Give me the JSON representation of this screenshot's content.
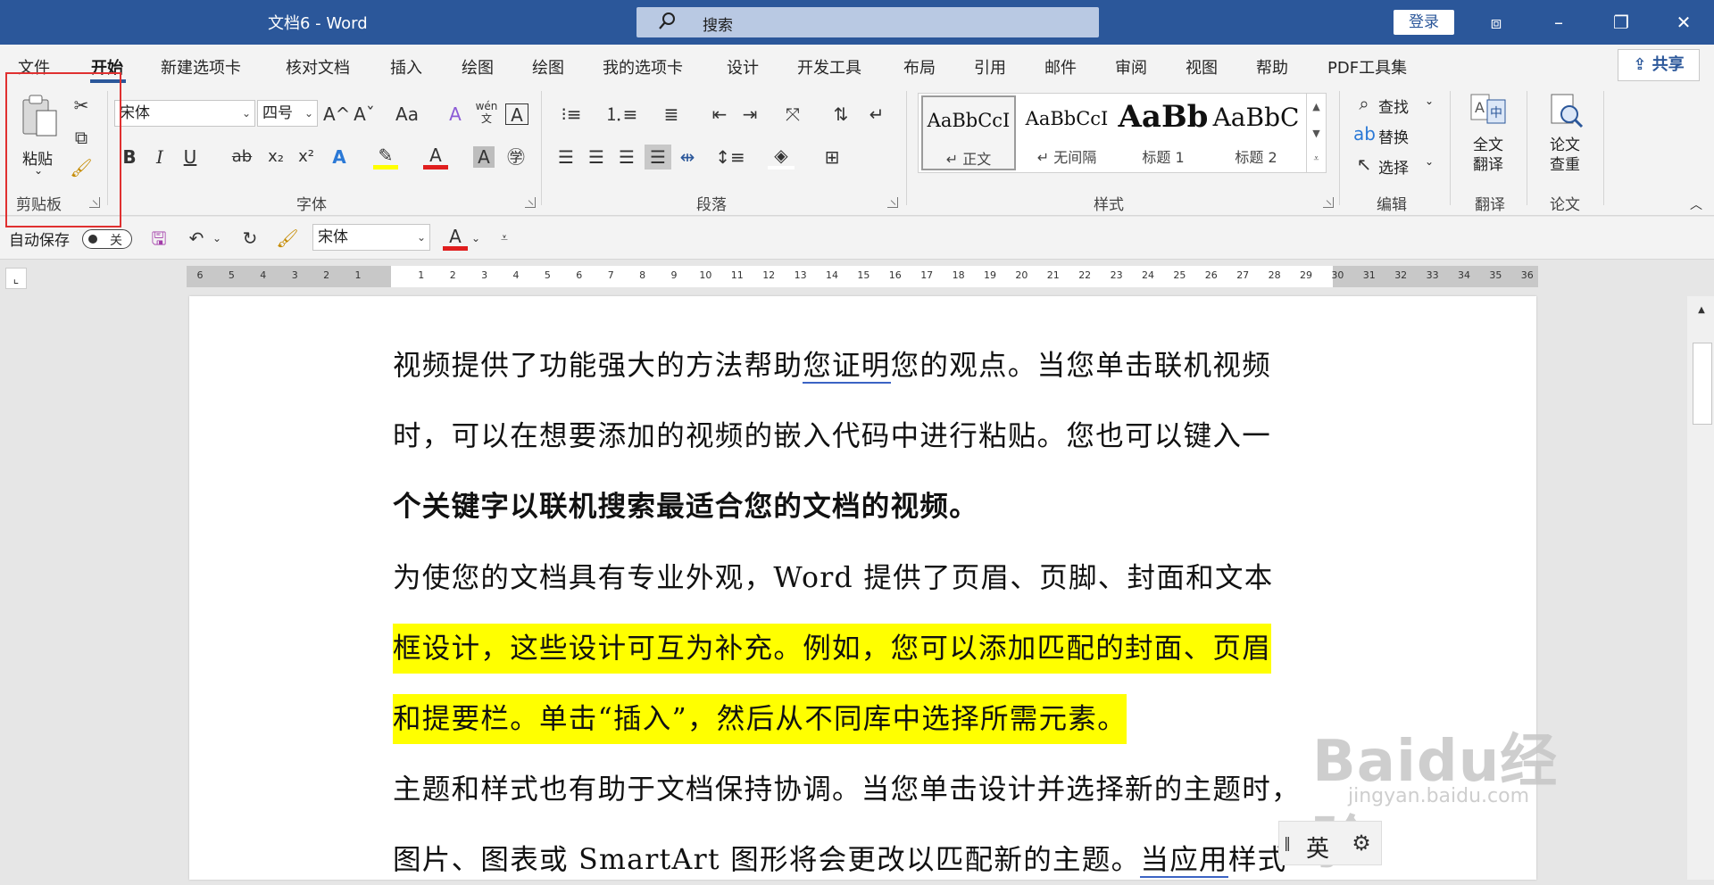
{
  "titlebar": {
    "title": "文档6  -  Word",
    "search_placeholder": "搜索",
    "login": "登录",
    "restore_ribbon": "⧈",
    "minimize": "–",
    "maximize": "❐",
    "close": "✕"
  },
  "tabs": [
    {
      "label": "文件"
    },
    {
      "label": "开始"
    },
    {
      "label": "新建选项卡"
    },
    {
      "label": "核对文档"
    },
    {
      "label": "插入"
    },
    {
      "label": "绘图"
    },
    {
      "label": "绘图"
    },
    {
      "label": "我的选项卡"
    },
    {
      "label": "设计"
    },
    {
      "label": "开发工具"
    },
    {
      "label": "布局"
    },
    {
      "label": "引用"
    },
    {
      "label": "邮件"
    },
    {
      "label": "审阅"
    },
    {
      "label": "视图"
    },
    {
      "label": "帮助"
    },
    {
      "label": "PDF工具集"
    }
  ],
  "share": "共享",
  "clipboard": {
    "paste": "粘贴",
    "group": "剪贴板"
  },
  "font": {
    "name": "宋体",
    "size": "四号",
    "group": "字体",
    "grow": "A^",
    "shrink": "Aˇ",
    "case": "Aa",
    "bold": "B",
    "italic": "I",
    "underline": "U",
    "strike": "ab",
    "sub": "x₂",
    "sup": "x²",
    "phonetic": "wén",
    "enclose": "A"
  },
  "paragraph": {
    "group": "段落"
  },
  "styles": {
    "group": "样式",
    "items": [
      {
        "preview": "AaBbCcI",
        "name": "↵ 正文"
      },
      {
        "preview": "AaBbCcI",
        "name": "↵ 无间隔"
      },
      {
        "preview": "AaBb",
        "name": "标题 1"
      },
      {
        "preview": "AaBbC",
        "name": "标题 2"
      }
    ]
  },
  "editing": {
    "find": "查找",
    "replace": "替换",
    "select": "选择",
    "group": "编辑"
  },
  "translate": {
    "label_1": "全文",
    "label_2": "翻译",
    "group": "翻译"
  },
  "paper": {
    "label_1": "论文",
    "label_2": "查重",
    "group": "论文"
  },
  "qat": {
    "autosave": "自动保存",
    "toggle": "关",
    "font": "宋体"
  },
  "ruler_numbers": [
    "6",
    "5",
    "4",
    "3",
    "2",
    "1",
    "",
    "1",
    "2",
    "3",
    "4",
    "5",
    "6",
    "7",
    "8",
    "9",
    "10",
    "11",
    "12",
    "13",
    "14",
    "15",
    "16",
    "17",
    "18",
    "19",
    "20",
    "21",
    "22",
    "23",
    "24",
    "25",
    "26",
    "27",
    "28",
    "29",
    "30",
    "31",
    "32",
    "33",
    "34",
    "35",
    "36"
  ],
  "document": {
    "lines": [
      {
        "a": "视频提供了功能强大的方法帮助",
        "u": "您证明",
        "b": "您的观点。当您单击联机视频"
      },
      {
        "text": "时，可以在想要添加的视频的嵌入代码中进行粘贴。您也可以键入一"
      },
      {
        "text": "个关键字以联机搜索最适合您的文档的视频。"
      },
      {
        "text": "为使您的文档具有专业外观，Word 提供了页眉、页脚、封面和文本"
      },
      {
        "text": "框设计，这些设计可互为补充。例如，您可以添加匹配的封面、页眉"
      },
      {
        "text": "和提要栏。单击“插入”，然后从不同库中选择所需元素。"
      },
      {
        "text": "主题和样式也有助于文档保持协调。当您单击设计并选择新的主题时，"
      },
      {
        "a": "图片、图表或 SmartArt 图形将会更改以匹配新的主题。",
        "u": "当应用",
        "b": "样式"
      }
    ]
  },
  "ime": {
    "lang": "英"
  },
  "watermark": {
    "brand": "Baidu经验",
    "url": "jingyan.baidu.com"
  }
}
